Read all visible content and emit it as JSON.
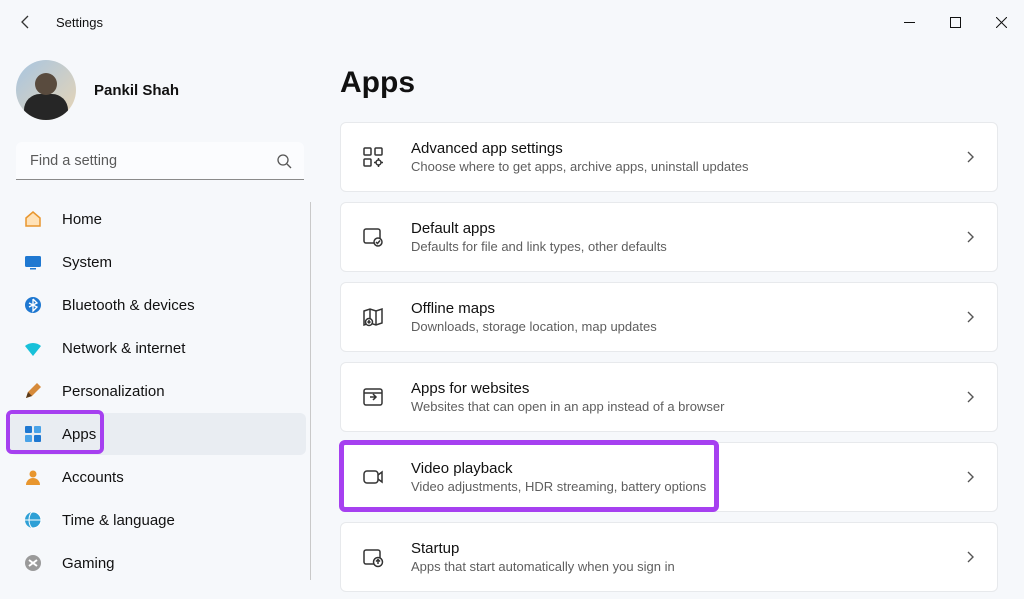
{
  "window": {
    "title": "Settings"
  },
  "user": {
    "name": "Pankil Shah"
  },
  "search": {
    "placeholder": "Find a setting"
  },
  "nav": {
    "items": [
      {
        "label": "Home"
      },
      {
        "label": "System"
      },
      {
        "label": "Bluetooth & devices"
      },
      {
        "label": "Network & internet"
      },
      {
        "label": "Personalization"
      },
      {
        "label": "Apps"
      },
      {
        "label": "Accounts"
      },
      {
        "label": "Time & language"
      },
      {
        "label": "Gaming"
      }
    ]
  },
  "page": {
    "title": "Apps"
  },
  "cards": [
    {
      "title": "Advanced app settings",
      "subtitle": "Choose where to get apps, archive apps, uninstall updates"
    },
    {
      "title": "Default apps",
      "subtitle": "Defaults for file and link types, other defaults"
    },
    {
      "title": "Offline maps",
      "subtitle": "Downloads, storage location, map updates"
    },
    {
      "title": "Apps for websites",
      "subtitle": "Websites that can open in an app instead of a browser"
    },
    {
      "title": "Video playback",
      "subtitle": "Video adjustments, HDR streaming, battery options"
    },
    {
      "title": "Startup",
      "subtitle": "Apps that start automatically when you sign in"
    }
  ],
  "highlights": {
    "navSelectedIndex": 5,
    "cardHighlightedIndex": 4,
    "color": "#a640f0"
  }
}
